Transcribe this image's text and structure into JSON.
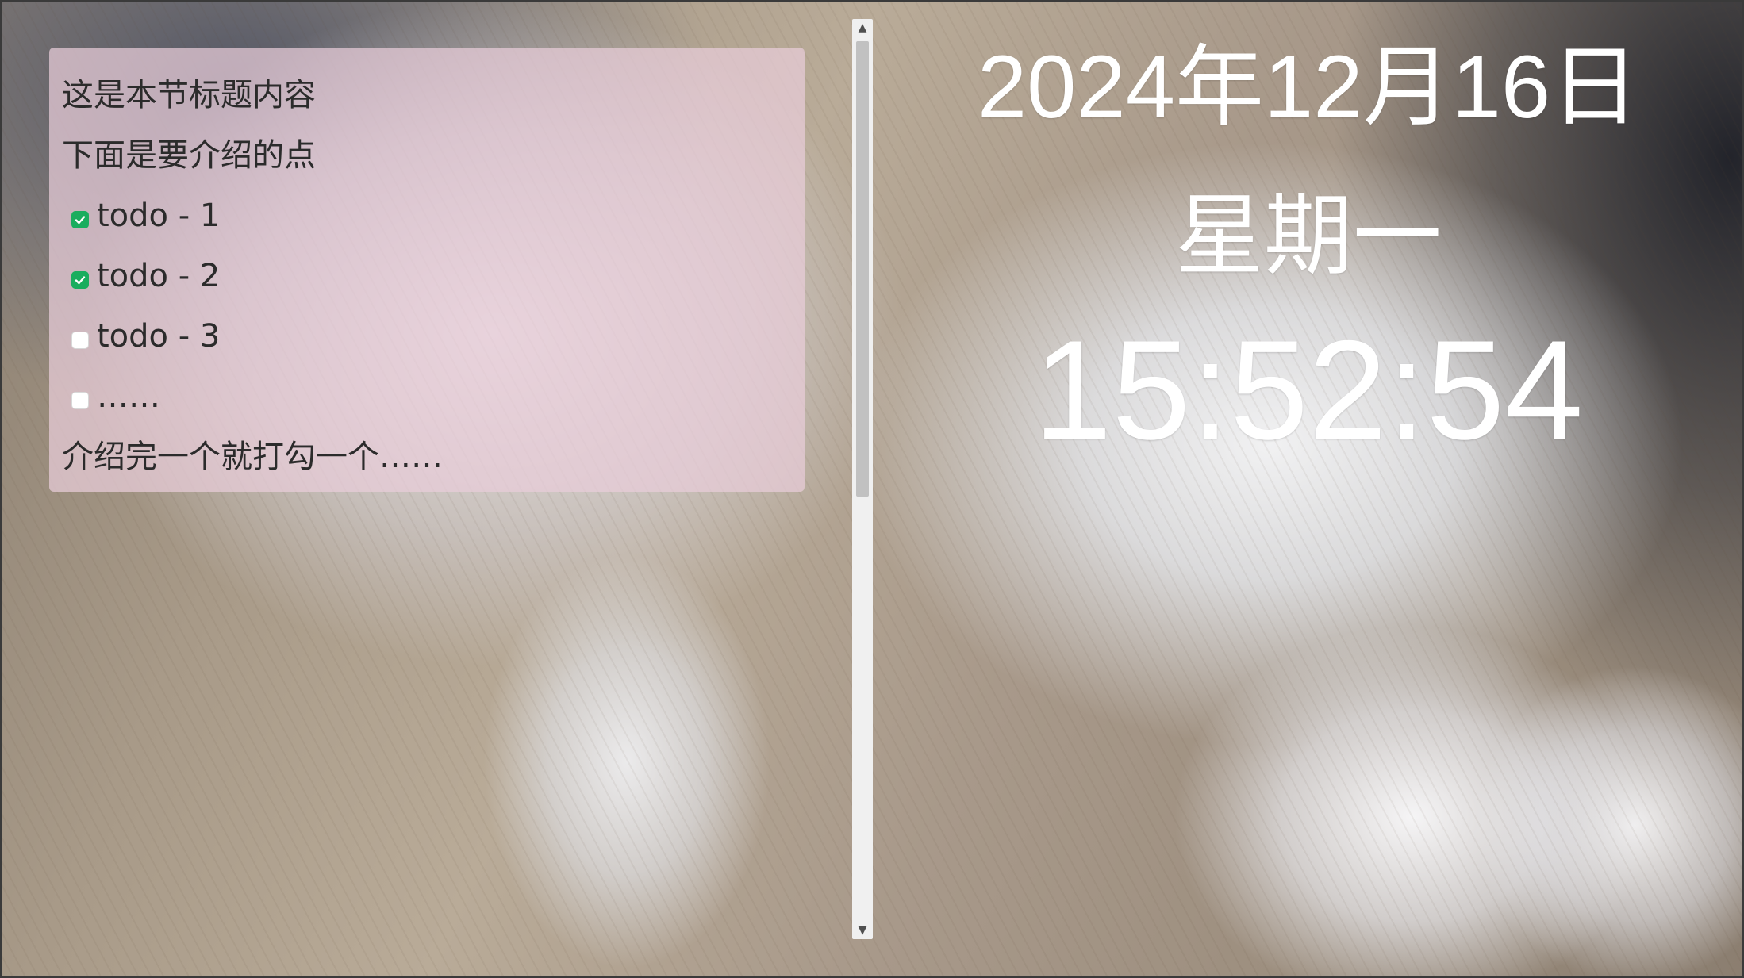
{
  "note": {
    "title_line": "这是本节标题内容",
    "subtitle_line": "下面是要介绍的点",
    "todos": [
      {
        "label": "todo - 1",
        "checked": true
      },
      {
        "label": "todo - 2",
        "checked": true
      },
      {
        "label": "todo - 3",
        "checked": false
      },
      {
        "label": "……",
        "checked": false
      }
    ],
    "footer_line": "介绍完一个就打勾一个……"
  },
  "clock": {
    "date": "2024年12月16日",
    "weekday": "星期一",
    "time": "15:52:54"
  },
  "scrollbar": {
    "up_arrow_icon": "▲",
    "down_arrow_icon": "▼",
    "thumb_fraction": 0.52
  },
  "colors": {
    "panel_tint": "#e9cdd9",
    "check_green": "#1aad5e",
    "clock_text": "#ffffff"
  }
}
